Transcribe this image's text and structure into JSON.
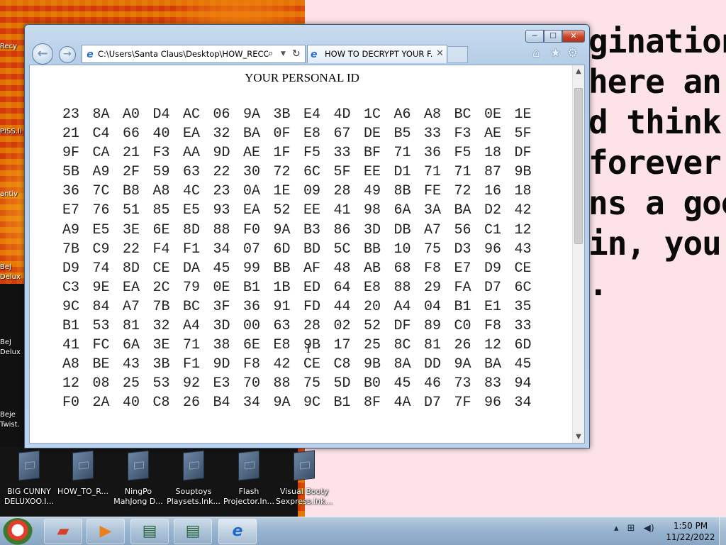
{
  "desktop": {
    "wallpaper_text": [
      "gination",
      "here an",
      "d think",
      "forever",
      "ns a goo",
      "in, you",
      "."
    ],
    "left_labels": [
      "Recy",
      "PISS.li",
      "antiv",
      "BeJ\nDelux",
      "BeJ\nDelux",
      "Beje\nTwist."
    ],
    "icons": [
      {
        "label": "BIG CUNNY\nDELUXOO.I..."
      },
      {
        "label": "HOW_TO_R..."
      },
      {
        "label": "NingPo\nMahJong D..."
      },
      {
        "label": "Souptoys\nPlaysets.lnk..."
      },
      {
        "label": "Flash\nProjector.In..."
      },
      {
        "label": "Visual Booty\nSexpress.lnk..."
      }
    ]
  },
  "browser": {
    "address": "C:\\Users\\Santa Claus\\Desktop\\HOW_RECOV",
    "tab_title": "HOW TO DECRYPT YOUR F...",
    "controls": {
      "minimize": "─",
      "maximize": "☐",
      "close": "✕"
    },
    "nav": {
      "back": "←",
      "forward": "→"
    }
  },
  "page": {
    "title": "YOUR PERSONAL ID",
    "hex_rows": [
      [
        "23",
        "8A",
        "A0",
        "D4",
        "AC",
        "06",
        "9A",
        "3B",
        "E4",
        "4D",
        "1C",
        "A6",
        "A8",
        "BC",
        "0E",
        "1E"
      ],
      [
        "21",
        "C4",
        "66",
        "40",
        "EA",
        "32",
        "BA",
        "0F",
        "E8",
        "67",
        "DE",
        "B5",
        "33",
        "F3",
        "AE",
        "5F"
      ],
      [
        "9F",
        "CA",
        "21",
        "F3",
        "AA",
        "9D",
        "AE",
        "1F",
        "F5",
        "33",
        "BF",
        "71",
        "36",
        "F5",
        "18",
        "DF"
      ],
      [
        "5B",
        "A9",
        "2F",
        "59",
        "63",
        "22",
        "30",
        "72",
        "6C",
        "5F",
        "EE",
        "D1",
        "71",
        "71",
        "87",
        "9B"
      ],
      [
        "36",
        "7C",
        "B8",
        "A8",
        "4C",
        "23",
        "0A",
        "1E",
        "09",
        "28",
        "49",
        "8B",
        "FE",
        "72",
        "16",
        "18"
      ],
      [
        "E7",
        "76",
        "51",
        "85",
        "E5",
        "93",
        "EA",
        "52",
        "EE",
        "41",
        "98",
        "6A",
        "3A",
        "BA",
        "D2",
        "42"
      ],
      [
        "A9",
        "E5",
        "3E",
        "6E",
        "8D",
        "88",
        "F0",
        "9A",
        "B3",
        "86",
        "3D",
        "DB",
        "A7",
        "56",
        "C1",
        "12"
      ],
      [
        "7B",
        "C9",
        "22",
        "F4",
        "F1",
        "34",
        "07",
        "6D",
        "BD",
        "5C",
        "BB",
        "10",
        "75",
        "D3",
        "96",
        "43"
      ],
      [
        "D9",
        "74",
        "8D",
        "CE",
        "DA",
        "45",
        "99",
        "BB",
        "AF",
        "48",
        "AB",
        "68",
        "F8",
        "E7",
        "D9",
        "CE"
      ],
      [
        "C3",
        "9E",
        "EA",
        "2C",
        "79",
        "0E",
        "B1",
        "1B",
        "ED",
        "64",
        "E8",
        "88",
        "29",
        "FA",
        "D7",
        "6C"
      ],
      [
        "9C",
        "84",
        "A7",
        "7B",
        "BC",
        "3F",
        "36",
        "91",
        "FD",
        "44",
        "20",
        "A4",
        "04",
        "B1",
        "E1",
        "35"
      ],
      [
        "B1",
        "53",
        "81",
        "32",
        "A4",
        "3D",
        "00",
        "63",
        "28",
        "02",
        "52",
        "DF",
        "89",
        "C0",
        "F8",
        "33"
      ],
      [
        "41",
        "FC",
        "6A",
        "3E",
        "71",
        "38",
        "6E",
        "E8",
        "9B",
        "17",
        "25",
        "8C",
        "81",
        "26",
        "12",
        "6D"
      ],
      [
        "A8",
        "BE",
        "43",
        "3B",
        "F1",
        "9D",
        "F8",
        "42",
        "CE",
        "C8",
        "9B",
        "8A",
        "DD",
        "9A",
        "BA",
        "45"
      ],
      [
        "12",
        "08",
        "25",
        "53",
        "92",
        "E3",
        "70",
        "88",
        "75",
        "5D",
        "B0",
        "45",
        "46",
        "73",
        "83",
        "94"
      ],
      [
        "F0",
        "2A",
        "40",
        "C8",
        "26",
        "B4",
        "34",
        "9A",
        "9C",
        "B1",
        "8F",
        "4A",
        "D7",
        "7F",
        "96",
        "34"
      ]
    ]
  },
  "taskbar": {
    "clock_time": "1:50 PM",
    "clock_date": "11/22/2022"
  }
}
